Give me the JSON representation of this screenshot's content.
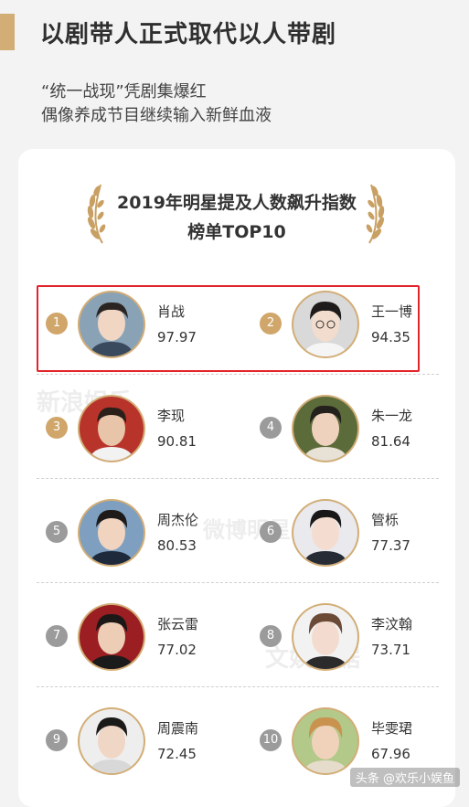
{
  "header": {
    "title": "以剧带人正式取代以人带剧",
    "subtitle_line1": "“统一战现”凭剧集爆红",
    "subtitle_line2": "偶像养成节目继续输入新鲜血液"
  },
  "card": {
    "title_line1": "2019年明星提及人数飙升指数",
    "title_line2": "榜单TOP10"
  },
  "ranking": [
    {
      "rank": "1",
      "name": "肖战",
      "score": "97.97",
      "badge": "gold"
    },
    {
      "rank": "2",
      "name": "王一博",
      "score": "94.35",
      "badge": "gold"
    },
    {
      "rank": "3",
      "name": "李现",
      "score": "90.81",
      "badge": "gold"
    },
    {
      "rank": "4",
      "name": "朱一龙",
      "score": "81.64",
      "badge": "gray"
    },
    {
      "rank": "5",
      "name": "周杰伦",
      "score": "80.53",
      "badge": "gray"
    },
    {
      "rank": "6",
      "name": "管栎",
      "score": "77.37",
      "badge": "gray"
    },
    {
      "rank": "7",
      "name": "张云雷",
      "score": "77.02",
      "badge": "gray"
    },
    {
      "rank": "8",
      "name": "李汶翰",
      "score": "73.71",
      "badge": "gray"
    },
    {
      "rank": "9",
      "name": "周震南",
      "score": "72.45",
      "badge": "gray"
    },
    {
      "rank": "10",
      "name": "毕雯珺",
      "score": "67.96",
      "badge": "gray"
    }
  ],
  "watermarks": {
    "sina": "新浪娱乐",
    "weibo": "微博明星",
    "data": "文娱数据"
  },
  "footer": {
    "credit": "头条 @欢乐小娱鱼"
  },
  "colors": {
    "accent_gold": "#d2ad76",
    "badge_gray": "#9b9b9b",
    "highlight_red": "#e2242b"
  }
}
